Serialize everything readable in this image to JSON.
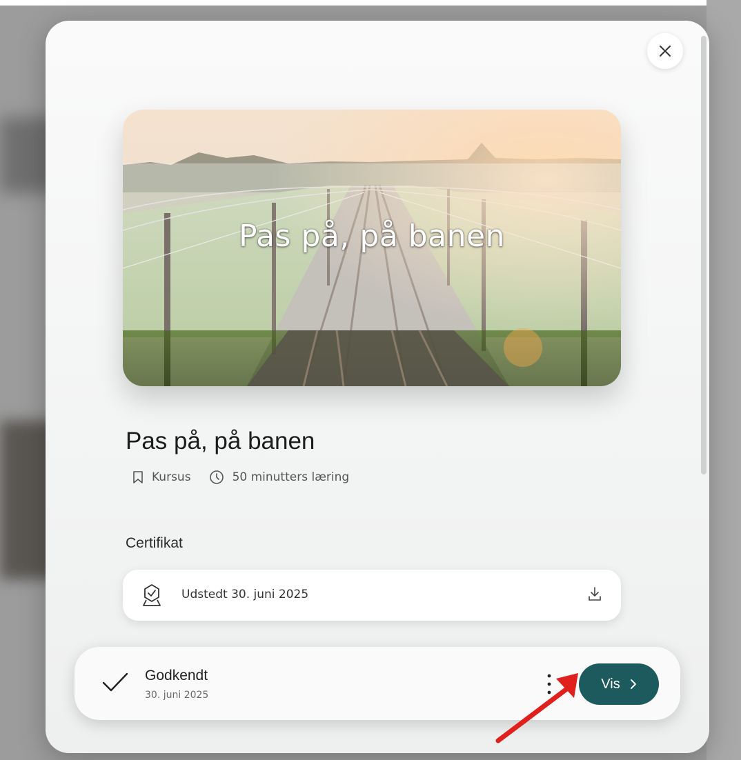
{
  "modal": {
    "close_label": "×",
    "hero": {
      "title": "Pas på, på banen"
    },
    "course": {
      "title": "Pas på, på banen",
      "type_label": "Kursus",
      "duration_label": "50 minutters læring"
    },
    "certificate": {
      "section_title": "Certifikat",
      "issued_label": "Udstedt 30. juni 2025"
    },
    "status": {
      "label": "Godkendt",
      "date": "30. juni 2025",
      "view_button": "Vis"
    }
  },
  "colors": {
    "accent": "#1d5a5d",
    "annotation_arrow": "#e0201c"
  },
  "icons": [
    "close-icon",
    "bookmark-icon",
    "clock-icon",
    "badge-check-icon",
    "download-icon",
    "checkmark-icon",
    "more-vertical-icon",
    "chevron-right-icon",
    "annotation-arrow"
  ]
}
